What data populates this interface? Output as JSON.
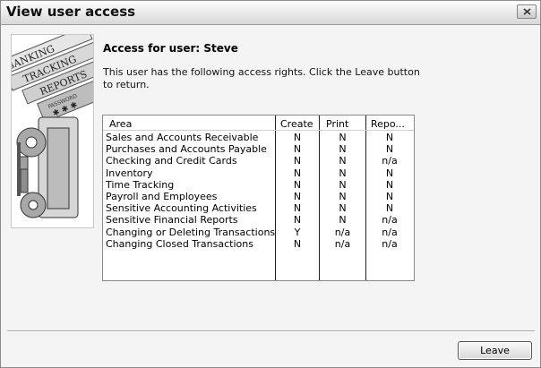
{
  "window": {
    "title": "View user access"
  },
  "content": {
    "heading": "Access for user: Steve",
    "description": "This user has the following access rights.  Click the Leave button to return."
  },
  "logo": {
    "words": [
      "BANKING",
      "TRACKING",
      "REPORTS",
      "PASSWORD"
    ]
  },
  "grid": {
    "headers": {
      "area": "Area",
      "create": "Create",
      "print": "Print",
      "reports": "Repo..."
    },
    "rows": [
      {
        "area": "Sales and Accounts Receivable",
        "create": "N",
        "print": "N",
        "reports": "N"
      },
      {
        "area": "Purchases and Accounts Payable",
        "create": "N",
        "print": "N",
        "reports": "N"
      },
      {
        "area": "Checking and Credit Cards",
        "create": "N",
        "print": "N",
        "reports": "n/a"
      },
      {
        "area": "Inventory",
        "create": "N",
        "print": "N",
        "reports": "N"
      },
      {
        "area": "Time Tracking",
        "create": "N",
        "print": "N",
        "reports": "N"
      },
      {
        "area": "Payroll and Employees",
        "create": "N",
        "print": "N",
        "reports": "N"
      },
      {
        "area": "Sensitive Accounting Activities",
        "create": "N",
        "print": "N",
        "reports": "N"
      },
      {
        "area": "Sensitive Financial Reports",
        "create": "N",
        "print": "N",
        "reports": "n/a"
      },
      {
        "area": "Changing or Deleting Transactions",
        "create": "Y",
        "print": "n/a",
        "reports": "n/a"
      },
      {
        "area": "Changing Closed Transactions",
        "create": "N",
        "print": "n/a",
        "reports": "n/a"
      }
    ]
  },
  "buttons": {
    "leave_label": "Leave",
    "close_icon": "close-x-icon"
  }
}
